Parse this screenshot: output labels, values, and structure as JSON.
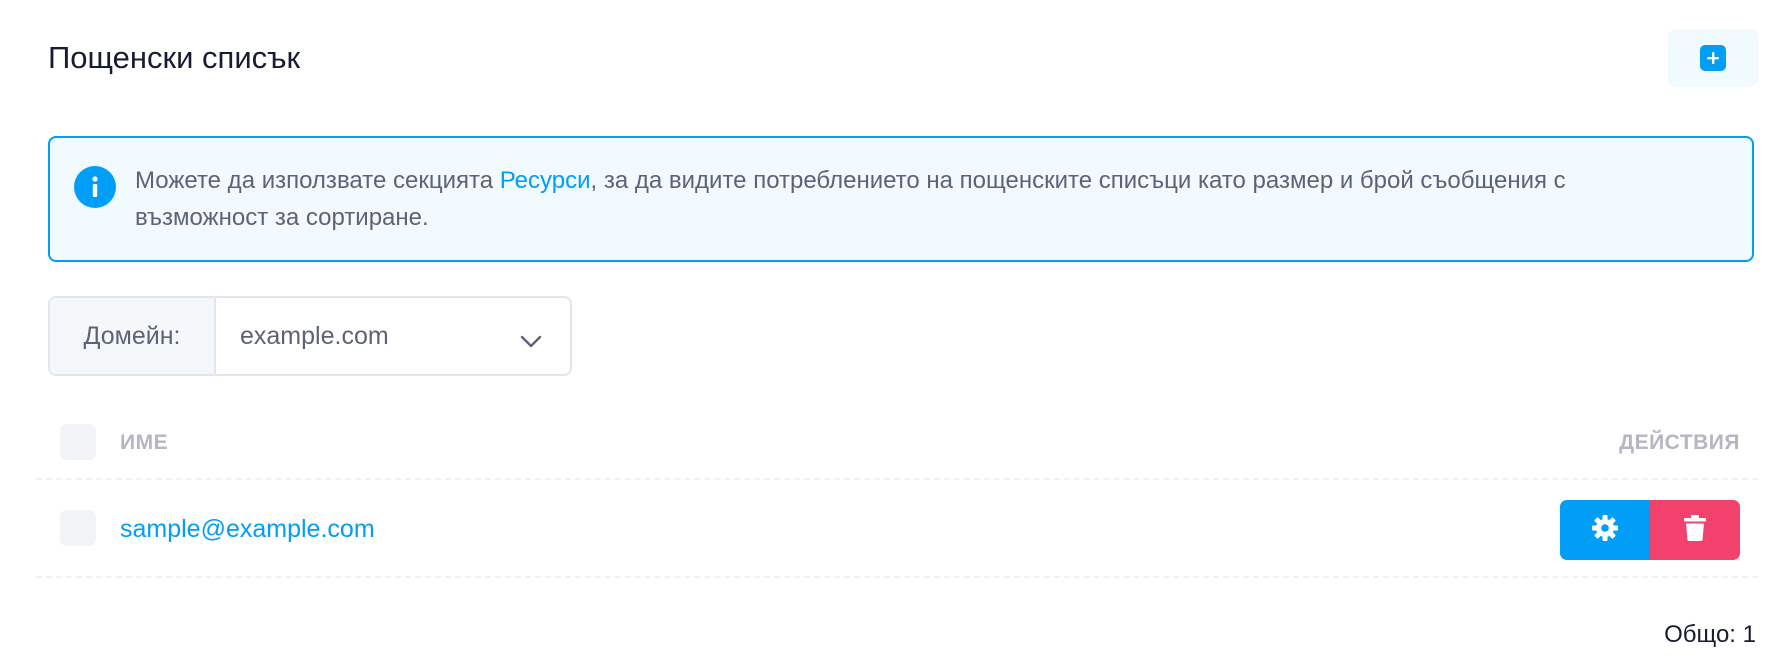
{
  "header": {
    "title": "Пощенски списък",
    "add_icon": "plus-square-icon"
  },
  "notice": {
    "icon": "info-icon",
    "text_before": "Можете да използвате секцията ",
    "link_text": "Ресурси",
    "text_after": ", за да видите потреблението на пощенските списъци като размер и брой съобщения с възможност за сортиране."
  },
  "domain_filter": {
    "label": "Домейн:",
    "selected": "example.com",
    "icon": "chevron-down-icon"
  },
  "table": {
    "columns": {
      "name": "ИМЕ",
      "actions": "ДЕЙСТВИЯ"
    },
    "rows": [
      {
        "email": "sample@example.com",
        "settings_icon": "gear-icon",
        "delete_icon": "trash-icon"
      }
    ]
  },
  "footer": {
    "total_label": "Общо:",
    "total_count": "1"
  },
  "colors": {
    "primary": "#009ef7",
    "danger": "#f1416c",
    "notice_bg": "#f1faff",
    "muted": "#b5b5c3"
  }
}
